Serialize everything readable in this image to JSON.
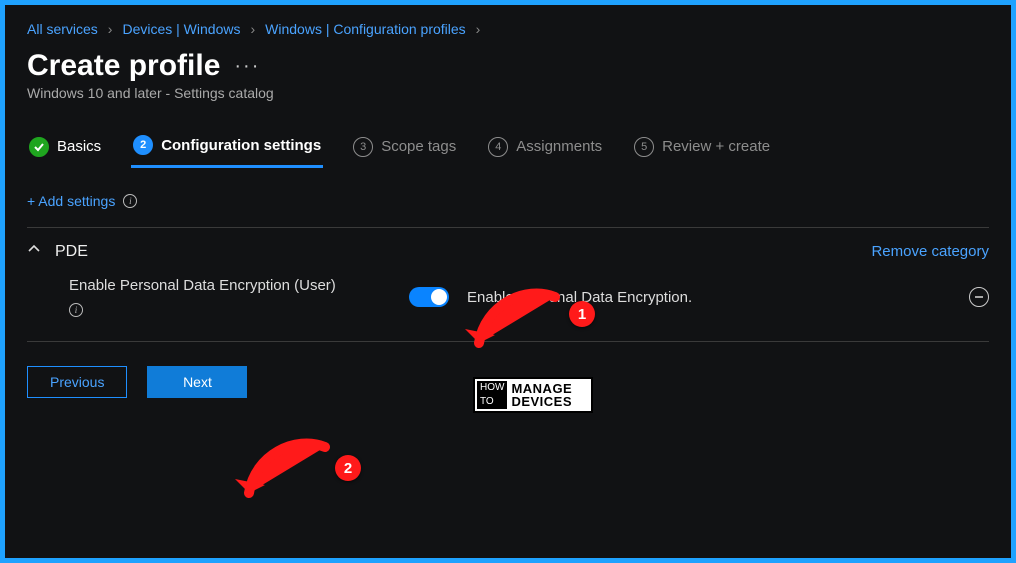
{
  "breadcrumb": [
    {
      "label": "All services"
    },
    {
      "label": "Devices | Windows"
    },
    {
      "label": "Windows | Configuration profiles"
    }
  ],
  "page": {
    "title": "Create profile",
    "subtitle": "Windows 10 and later - Settings catalog"
  },
  "steps": [
    {
      "label": "Basics",
      "state": "done",
      "num": "✓"
    },
    {
      "label": "Configuration settings",
      "state": "active",
      "num": "2"
    },
    {
      "label": "Scope tags",
      "state": "todo",
      "num": "3"
    },
    {
      "label": "Assignments",
      "state": "todo",
      "num": "4"
    },
    {
      "label": "Review + create",
      "state": "todo",
      "num": "5"
    }
  ],
  "add_settings": {
    "text": "+ Add settings"
  },
  "category": {
    "title": "PDE",
    "remove_label": "Remove category",
    "setting": {
      "label": "Enable Personal Data Encryption (User)",
      "toggle_on": true,
      "toggle_label": "Enable Personal Data Encryption."
    }
  },
  "buttons": {
    "previous": "Previous",
    "next": "Next"
  },
  "annotations": {
    "badge1": "1",
    "badge2": "2"
  },
  "logo": {
    "line1a": "HOW",
    "line1b": "TO",
    "line2a": "MANAGE",
    "line2b": "DEVICES"
  }
}
